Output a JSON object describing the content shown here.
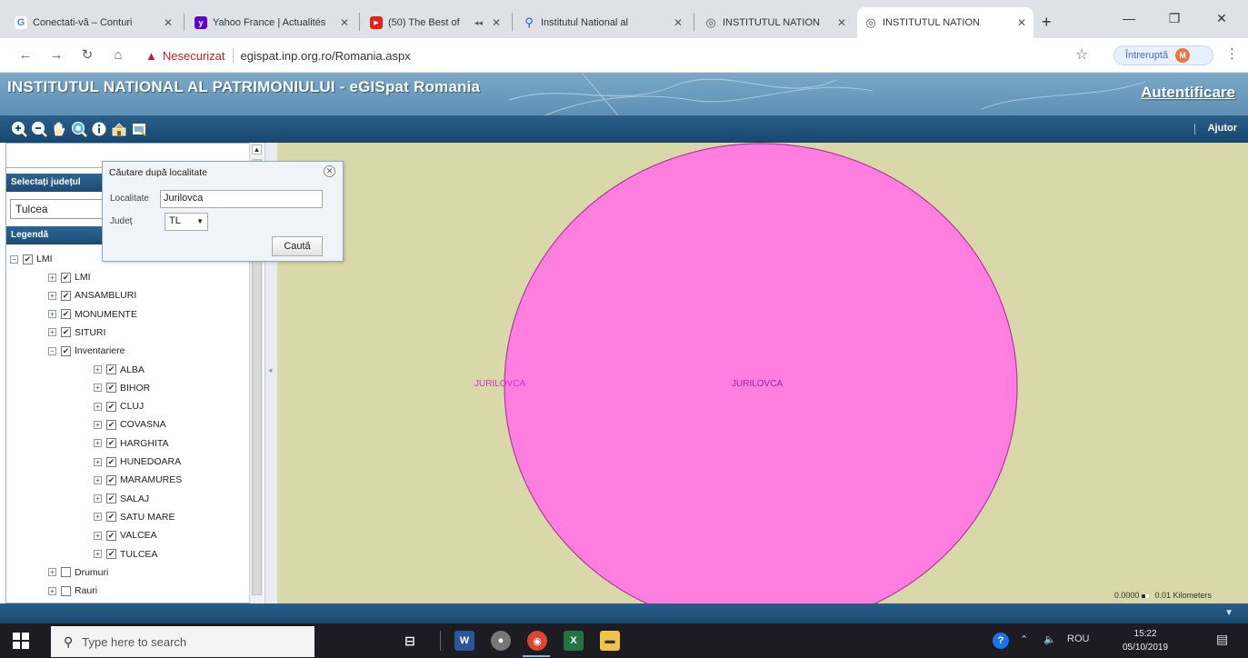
{
  "browser": {
    "tabs": [
      {
        "title": "Conectati-vă – Conturi",
        "favicon": "google-icon",
        "color": "#4285f4"
      },
      {
        "title": "Yahoo France | Actualités",
        "favicon": "yahoo-icon",
        "color": "#6001d2"
      },
      {
        "title": "(50) The Best of",
        "favicon": "youtube-icon",
        "color": "#e62117"
      },
      {
        "title": "Institutul National al",
        "favicon": "search-icon",
        "color": "#2a62c9"
      },
      {
        "title": "INSTITUTUL NATION",
        "favicon": "globe-icon",
        "color": "#555"
      },
      {
        "title": "INSTITUTUL NATION",
        "favicon": "globe-icon",
        "color": "#555"
      }
    ],
    "address": {
      "security_label": "Nesecurizat",
      "url": "egispat.inp.org.ro/Romania.aspx"
    },
    "profile": {
      "label": "Întreruptă",
      "initial": "M"
    }
  },
  "app": {
    "title": "INSTITUTUL NATIONAL AL PATRIMONIULUI - eGISpat Romania",
    "auth_link": "Autentificare",
    "help_link": "Ajutor",
    "tools": [
      "zoom-in-icon",
      "zoom-out-icon",
      "pan-hand-icon",
      "zoom-extent-icon",
      "info-icon",
      "search-locality-icon",
      "print-icon"
    ]
  },
  "left_panel": {
    "county_header": "Selectați județul",
    "county_selected": "Tulcea",
    "legend_header": "Legendă",
    "tree": {
      "root": "LMI",
      "children": [
        {
          "label": "LMI",
          "checked": true,
          "level": 1
        },
        {
          "label": "ANSAMBLURI",
          "checked": true,
          "level": 1
        },
        {
          "label": "MONUMENTE",
          "checked": true,
          "level": 1
        },
        {
          "label": "SITURI",
          "checked": true,
          "level": 1
        },
        {
          "label": "Inventariere",
          "checked": true,
          "level": 1,
          "expanded": true
        },
        {
          "label": "ALBA",
          "checked": true,
          "level": 2
        },
        {
          "label": "BIHOR",
          "checked": true,
          "level": 2
        },
        {
          "label": "CLUJ",
          "checked": true,
          "level": 2
        },
        {
          "label": "COVASNA",
          "checked": true,
          "level": 2
        },
        {
          "label": "HARGHITA",
          "checked": true,
          "level": 2
        },
        {
          "label": "HUNEDOARA",
          "checked": true,
          "level": 2
        },
        {
          "label": "MARAMURES",
          "checked": true,
          "level": 2
        },
        {
          "label": "SALAJ",
          "checked": true,
          "level": 2
        },
        {
          "label": "SATU MARE",
          "checked": true,
          "level": 2
        },
        {
          "label": "VALCEA",
          "checked": true,
          "level": 2
        },
        {
          "label": "TULCEA",
          "checked": true,
          "level": 2
        },
        {
          "label": "Drumuri",
          "checked": false,
          "level": 1
        },
        {
          "label": "Rauri",
          "checked": false,
          "level": 1
        }
      ]
    }
  },
  "search_popup": {
    "title": "Căutare după localitate",
    "locality_label": "Localitate",
    "locality_value": "Jurilovca",
    "county_label": "Județ",
    "county_value": "TL",
    "submit": "Caută"
  },
  "map": {
    "labels": [
      "JURILOVCA",
      "JURILOVCA"
    ],
    "scale_label": "0.01 Kilometers",
    "scale_ticks": "0.0000",
    "colors": {
      "background": "#d8d8a8",
      "feature": "#ff7ee0",
      "feature_stroke": "#b03aa0"
    }
  },
  "taskbar": {
    "search_placeholder": "Type here to search",
    "language": "ROU",
    "time": "15:22",
    "date": "05/10/2019"
  }
}
